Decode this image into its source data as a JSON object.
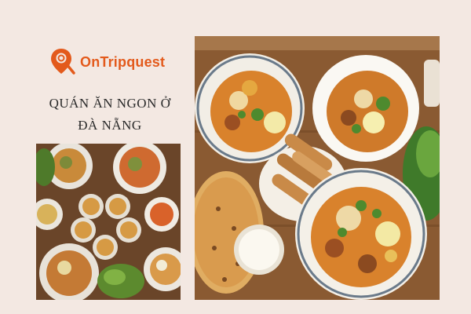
{
  "brand": {
    "name": "OnTripquest",
    "color": "#e35a1c",
    "icon": "map-pin-search-icon"
  },
  "headline": {
    "line1": "QUÁN ĂN NGON Ở",
    "line2": "ĐÀ NẴNG"
  },
  "photos": [
    {
      "subject": "food-spread-small-photo"
    },
    {
      "subject": "mi-quang-bowls-photo"
    }
  ]
}
